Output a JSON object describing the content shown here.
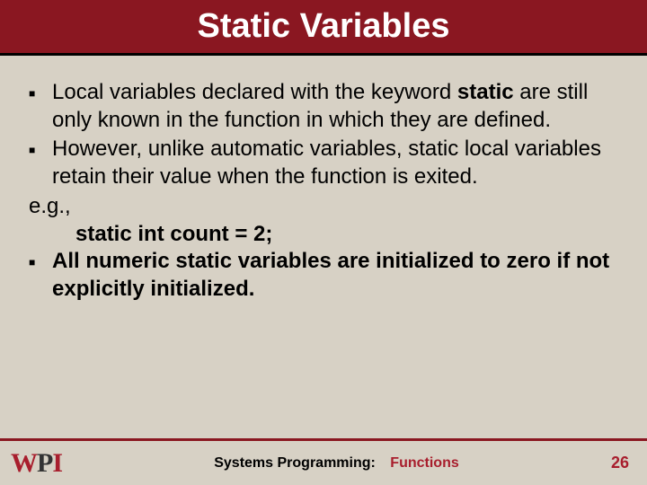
{
  "header": {
    "title": "Static Variables"
  },
  "bullets": {
    "b1a": "Local variables declared with the keyword ",
    "b1b": "static",
    "b1c": " are still only known in the function in which they are defined.",
    "b2": "However, unlike automatic variables, static local variables retain their value when the function is exited.",
    "eg": "e.g.,",
    "code": "static int count = 2;",
    "b3": "All numeric static variables are initialized to zero if not explicitly initialized."
  },
  "footer": {
    "logo_w": "W",
    "logo_p": "P",
    "logo_i": "I",
    "label": "Systems Programming:",
    "topic": "Functions",
    "page": "26"
  }
}
